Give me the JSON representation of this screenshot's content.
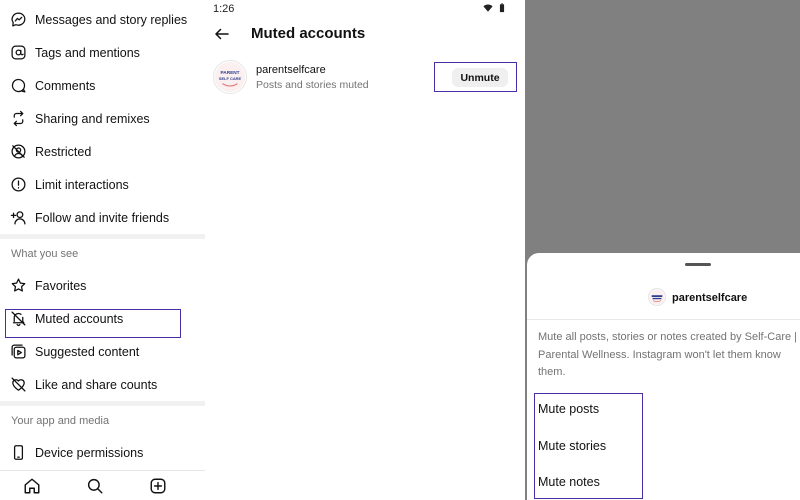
{
  "left_panel": {
    "items_top": [
      {
        "label": "Messages and story replies",
        "icon": "messenger-icon"
      },
      {
        "label": "Tags and mentions",
        "icon": "at-sign-icon"
      },
      {
        "label": "Comments",
        "icon": "comment-bubble-icon"
      },
      {
        "label": "Sharing and remixes",
        "icon": "repost-icon"
      },
      {
        "label": "Restricted",
        "icon": "restricted-icon"
      },
      {
        "label": "Limit interactions",
        "icon": "alert-circle-icon"
      },
      {
        "label": "Follow and invite friends",
        "icon": "add-person-icon"
      }
    ],
    "section_what_you_see": "What you see",
    "items_what_you_see": [
      {
        "label": "Favorites",
        "icon": "star-icon"
      },
      {
        "label": "Muted accounts",
        "icon": "muted-bell-icon"
      },
      {
        "label": "Suggested content",
        "icon": "suggested-content-icon"
      },
      {
        "label": "Like and share counts",
        "icon": "hidden-heart-icon"
      }
    ],
    "section_app_media": "Your app and media",
    "items_app_media": [
      {
        "label": "Device permissions",
        "icon": "phone-icon"
      }
    ],
    "bottom_nav": [
      "home-icon",
      "search-icon",
      "create-icon"
    ]
  },
  "middle_panel": {
    "status_time": "1:26",
    "title": "Muted accounts",
    "accounts": [
      {
        "username": "parentselfcare",
        "subtitle": "Posts and stories muted",
        "avatar_text_top": "PARENT",
        "avatar_text_bottom": "SELF CARE",
        "action_label": "Unmute"
      }
    ]
  },
  "mute_sheet": {
    "username": "parentselfcare",
    "description": "Mute all posts, stories or notes created by Self-Care | Parental Wellness. Instagram won't let them know",
    "description_cont": "them.",
    "options": [
      "Mute posts",
      "Mute stories",
      "Mute notes"
    ]
  },
  "colors": {
    "highlight_border": "#4a2fa8",
    "overlay": "#808080",
    "secondary_text": "#737373",
    "button_bg": "#efefef"
  }
}
